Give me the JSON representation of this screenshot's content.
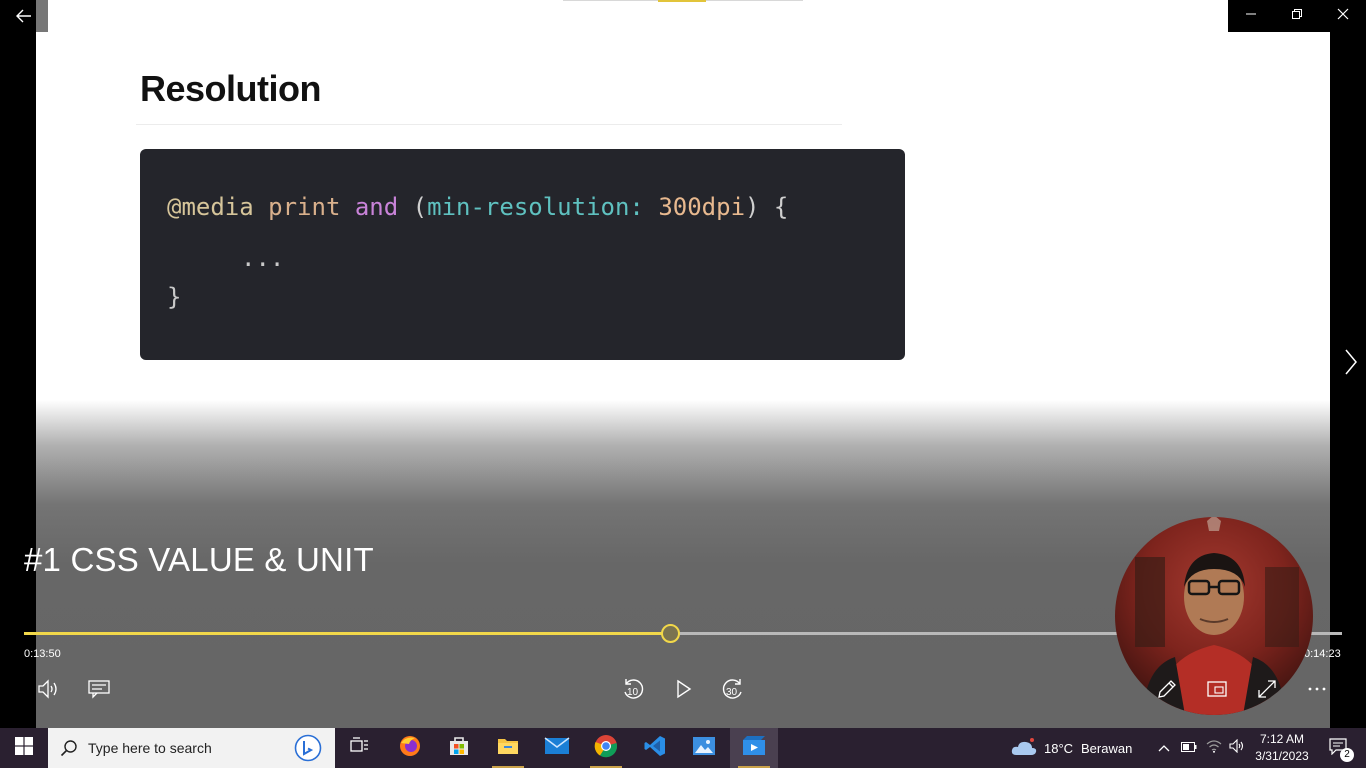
{
  "slide": {
    "heading": "Resolution",
    "code": {
      "line1": {
        "at_media": "@media",
        "print": "print",
        "and": "and",
        "open_paren": "(",
        "property": "min-resolution:",
        "value": "300dpi",
        "close": ") {"
      },
      "line2": "...",
      "line3": "}"
    }
  },
  "player": {
    "title": "#1 CSS VALUE & UNIT",
    "time_current": "0:13:50",
    "time_total": "0:14:23",
    "progress_fraction": 0.49,
    "skip_back_label": "10",
    "skip_forward_label": "30",
    "accent_color": "#f2d84a"
  },
  "window": {
    "back_icon": "arrow-left-icon",
    "minimize_icon": "minimize-icon",
    "restore_icon": "restore-icon",
    "close_icon": "close-icon"
  },
  "taskbar": {
    "search_placeholder": "Type here to search",
    "apps": [
      "task-view",
      "firefox",
      "microsoft-store",
      "file-explorer",
      "mail",
      "chrome",
      "vs-code",
      "photos",
      "movies-tv"
    ],
    "weather": {
      "temp": "18°C",
      "desc": "Berawan"
    },
    "clock": {
      "time": "7:12 AM",
      "date": "3/31/2023"
    },
    "notification_count": "2"
  }
}
